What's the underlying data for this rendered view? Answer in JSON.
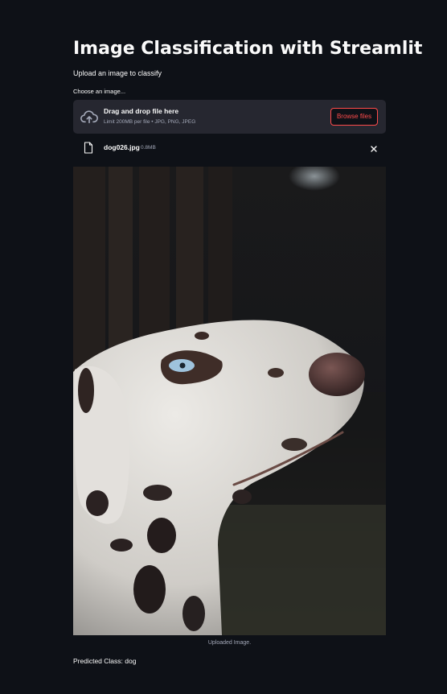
{
  "page": {
    "title": "Image Classification with Streamlit",
    "subtitle": "Upload an image to classify"
  },
  "uploader": {
    "label": "Choose an image...",
    "drop_title": "Drag and drop file here",
    "limit_text": "Limit 200MB per file • JPG, PNG, JPEG",
    "browse_label": "Browse files",
    "icon": "cloud-upload-icon"
  },
  "file": {
    "name": "dog026.jpg",
    "size": "0.8MB",
    "icon": "file-icon",
    "close_icon": "close-icon"
  },
  "image": {
    "caption": "Uploaded Image."
  },
  "result": {
    "prediction_text": "Predicted Class: dog"
  },
  "colors": {
    "background": "#0e1117",
    "surface": "#262730",
    "accent": "#ff4b4b",
    "muted_text": "#a3a8b8"
  }
}
